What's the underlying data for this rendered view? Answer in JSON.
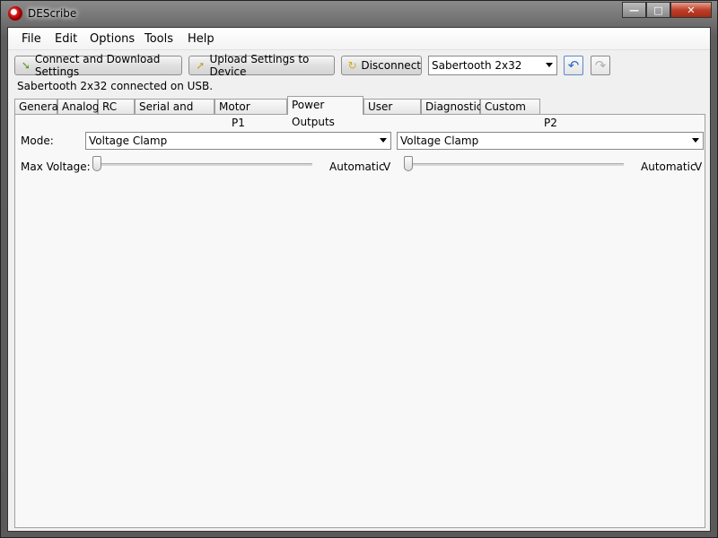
{
  "window": {
    "title": "DEScribe"
  },
  "caption": {
    "minimize": "—",
    "maximize": "□",
    "close": "✕"
  },
  "menu": [
    "File",
    "Edit",
    "Options",
    "Tools",
    "Help"
  ],
  "toolbar": {
    "connect_label": "Connect and Download Settings",
    "upload_label": "Upload Settings to Device",
    "disconnect_label": "Disconnect",
    "device_selected": "Sabertooth 2x32",
    "undo_icon": "undo-icon",
    "redo_icon": "redo-icon"
  },
  "status": {
    "text": "Sabertooth 2x32 connected on USB."
  },
  "tabs": [
    "General",
    "Analog",
    "RC",
    "Serial and USB",
    "Motor Outputs",
    "Power Outputs",
    "User Mode",
    "Diagnostics",
    "Custom Test"
  ],
  "active_tab": "Power Outputs",
  "power": {
    "mode_label": "Mode:",
    "max_voltage_label": "Max Voltage:",
    "p1": {
      "header": "P1",
      "mode": "Voltage Clamp",
      "slider_value": "Automatic",
      "unit": "V"
    },
    "p2": {
      "header": "P2",
      "mode": "Voltage Clamp",
      "slider_value": "Automatic",
      "unit": "V"
    }
  }
}
